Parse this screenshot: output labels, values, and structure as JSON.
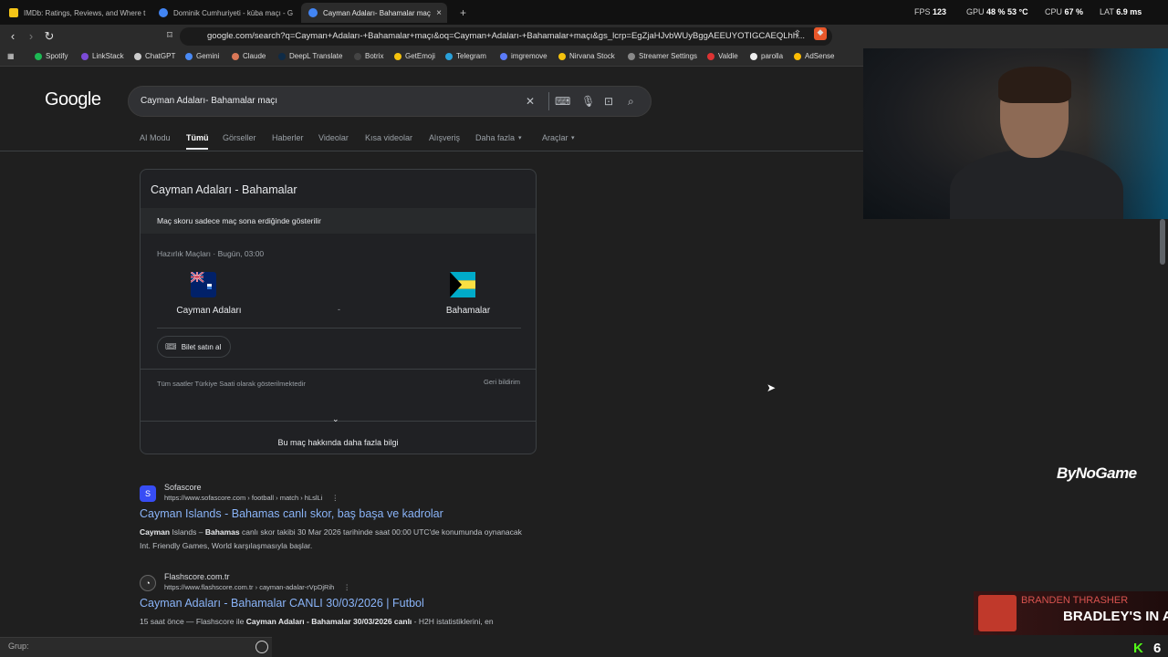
{
  "browser": {
    "tabs": [
      {
        "title": "IMDb: Ratings, Reviews, and Where t",
        "color": "#f5c518"
      },
      {
        "title": "Dominik Cumhuriyeti - küba maçı - G",
        "color": "#4285f4"
      },
      {
        "title": "Cayman Adaları- Bahamalar maç",
        "color": "#4285f4"
      }
    ],
    "new_tab": "+",
    "close": "×",
    "url": "google.com/search?q=Cayman+Adaları-+Bahamalar+maçı&oq=Cayman+Adaları-+Bahamalar+maçı&gs_lcrp=EgZjaHJvbWUyBggAEEUYOTIGCAEQLhh...",
    "stats": {
      "fps_label": "FPS",
      "fps": "123",
      "gpu_label": "GPU",
      "gpu": "48 % 53 °C",
      "cpu_label": "CPU",
      "cpu": "67 %",
      "lat_label": "LAT",
      "lat": "6.9 ms"
    },
    "bookmarks": [
      {
        "label": "Spotify",
        "color": "#1db954"
      },
      {
        "label": "LinkStack",
        "color": "#7b4bd6"
      },
      {
        "label": "ChatGPT",
        "color": "#cccccc"
      },
      {
        "label": "Gemini",
        "color": "#4a8af4"
      },
      {
        "label": "Claude",
        "color": "#d97757"
      },
      {
        "label": "DeepL Translate",
        "color": "#0f2b46"
      },
      {
        "label": "Botrix",
        "color": "#444"
      },
      {
        "label": "GetEmoji",
        "color": "#f4c20d"
      },
      {
        "label": "Telegram",
        "color": "#2aa1da"
      },
      {
        "label": "imgremove",
        "color": "#5b7cfa"
      },
      {
        "label": "Nirvana Stock",
        "color": "#f4c20d"
      },
      {
        "label": "Streamer Settings",
        "color": "#888"
      },
      {
        "label": "Valdle",
        "color": "#d33"
      },
      {
        "label": "parolla",
        "color": "#eee"
      },
      {
        "label": "AdSense",
        "color": "#fbbc04"
      }
    ]
  },
  "google": {
    "logo": "Google",
    "query": "Cayman Adaları- Bahamalar maçı",
    "nav": [
      "AI Modu",
      "Tümü",
      "Görseller",
      "Haberler",
      "Videolar",
      "Kısa videolar",
      "Alışveriş",
      "Daha fazla",
      "Araçlar"
    ],
    "card": {
      "title": "Cayman Adaları - Bahamalar",
      "score_note": "Maç skoru sadece maç sona erdiğinde gösterilir",
      "meta": "Hazırlık Maçları · Bugün, 03:00",
      "home": "Cayman Adaları",
      "away": "Bahamalar",
      "vs": "-",
      "ticket": "Bilet satın al",
      "timezone_note": "Tüm saatler Türkiye Saati olarak gösterilmektedir",
      "feedback": "Geri bildirim",
      "more_info": "Bu maç hakkında daha fazla bilgi"
    },
    "results": [
      {
        "site": "Sofascore",
        "url": "https://www.sofascore.com › football › match › hLslLi",
        "title": "Cayman Islands - Bahamas canlı skor, baş başa ve kadrolar",
        "snippet_bold1": "Cayman",
        "snippet_mid1": " Islands – ",
        "snippet_bold2": "Bahamas",
        "snippet_rest": " canlı skor takibi 30 Mar 2026 tarihinde saat 00:00 UTC'de konumunda oynanacak Int. Friendly Games, World karşılaşmasıyla başlar."
      },
      {
        "site": "Flashscore.com.tr",
        "url": "https://www.flashscore.com.tr › cayman-adalar-rVpDjRih",
        "title": "Cayman Adaları - Bahamalar CANLI 30/03/2026 | Futbol",
        "snippet_pre": "15 saat önce — Flashscore ile ",
        "snippet_bold": "Cayman Adaları - Bahamalar 30/03/2026 canlı",
        "snippet_rest": " - H2H istatistiklerini, en"
      }
    ]
  },
  "overlays": {
    "brand": "ByNoGame",
    "alert_name": "BRANDEN THRASHER",
    "alert_msg": "BRADLEY'S IN A",
    "group_label": "Grup:",
    "kick_logo": "K",
    "kick_count": "6"
  }
}
